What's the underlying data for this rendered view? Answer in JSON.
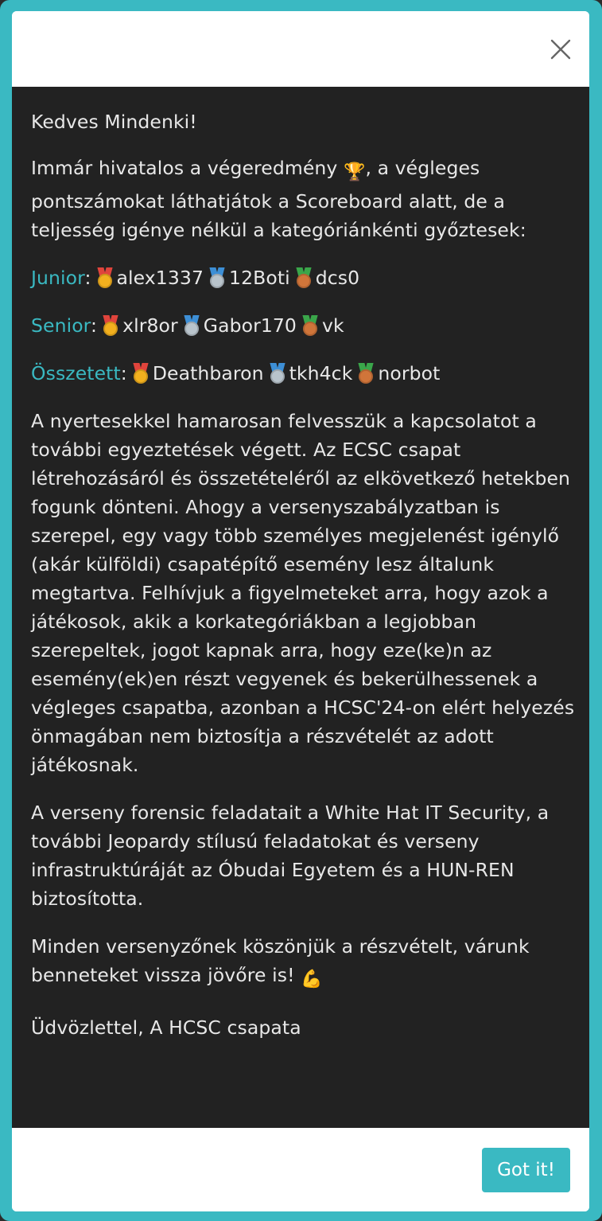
{
  "greeting": "Kedves Mindenki!",
  "intro": {
    "before_trophy": "Immár hivatalos a végeredmény ",
    "trophy_icon": "trophy-icon",
    "after_trophy": ", a végleges pontszámokat láthatjátok a Scoreboard alatt, de a teljesség igénye nélkül a kategóriánkénti győztesek:"
  },
  "categories": [
    {
      "label": "Junior",
      "first": "alex1337",
      "second": "12Boti",
      "third": "dcs0"
    },
    {
      "label": "Senior",
      "first": "xlr8or",
      "second": "Gabor170",
      "third": "vk"
    },
    {
      "label": "Összetett",
      "first": "Deathbaron",
      "second": "tkh4ck",
      "third": "norbot"
    }
  ],
  "paragraph_winners": "A nyertesekkel hamarosan felvesszük a kapcsolatot a további egyeztetések végett. Az ECSC csapat létrehozásáról és összetételéről az elkövetkező hetekben fogunk dönteni. Ahogy a versenyszabályzatban is szerepel, egy vagy több személyes megjelenést igénylő (akár külföldi) csapatépítő esemény lesz általunk megtartva. Felhívjuk a figyelmeteket arra, hogy azok a játékosok, akik a korkategóriákban a legjobban szerepeltek, jogot kapnak arra, hogy eze(ke)n az esemény(ek)en részt vegyenek és bekerülhessenek a végleges csapatba, azonban a HCSC'24-on elért helyezés önmagában nem biztosítja a részvételét az adott játékosnak.",
  "paragraph_sponsors": "A verseny forensic feladatait a White Hat IT Security, a további Jeopardy stílusú feladatokat és verseny infrastruktúráját az Óbudai Egyetem és a HUN-REN biztosította.",
  "thanks": {
    "text": "Minden versenyzőnek köszönjük a részvételt, várunk benneteket vissza jövőre is! ",
    "icon": "flexed-biceps-icon"
  },
  "signature": "Üdvözlettel, A HCSC csapata",
  "button_label": "Got it!",
  "colors": {
    "accent": "#3ab9c2",
    "body_bg": "#222222",
    "text": "#e8e8e8"
  }
}
